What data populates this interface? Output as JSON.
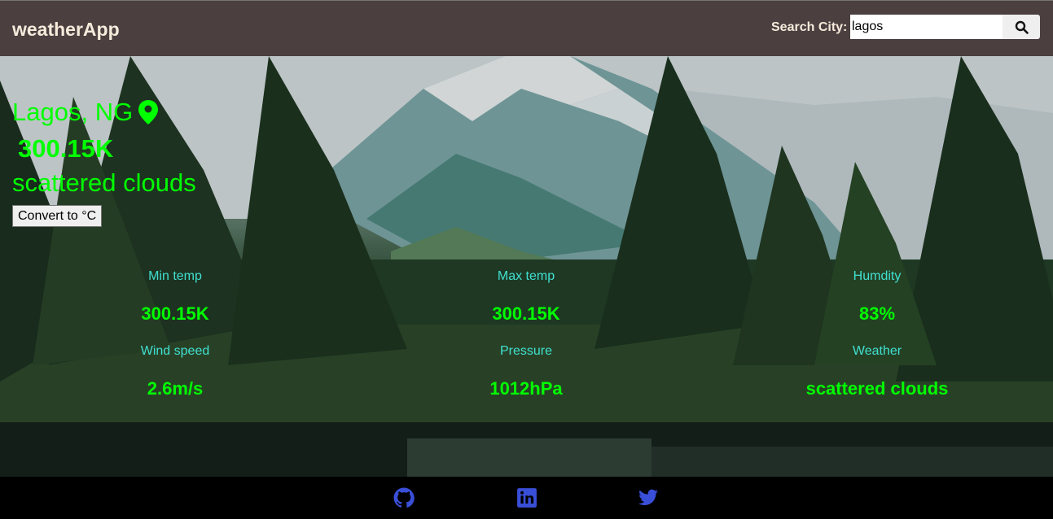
{
  "header": {
    "brand": "weatherApp",
    "search_label": "Search City:",
    "search_value": "lagos",
    "search_icon": "search-icon"
  },
  "current": {
    "location": "Lagos, NG",
    "location_icon": "map-pin-icon",
    "temperature": "300.15K",
    "description": "scattered clouds",
    "convert_label": "Convert to °C"
  },
  "stats": [
    {
      "label": "Min temp",
      "value": "300.15K"
    },
    {
      "label": "Max temp",
      "value": "300.15K"
    },
    {
      "label": "Humdity",
      "value": "83%"
    },
    {
      "label": "Wind speed",
      "value": "2.6m/s"
    },
    {
      "label": "Pressure",
      "value": "1012hPa"
    },
    {
      "label": "Weather",
      "value": "scattered clouds"
    }
  ],
  "footer": {
    "icons": [
      "github-icon",
      "linkedin-icon",
      "twitter-icon"
    ]
  },
  "colors": {
    "header_bg": "#4b3f40",
    "brand_text": "#f6eadb",
    "primary_text": "#00ff00",
    "label_text": "#40e0d0",
    "social_icons": "#3a4fd8"
  }
}
